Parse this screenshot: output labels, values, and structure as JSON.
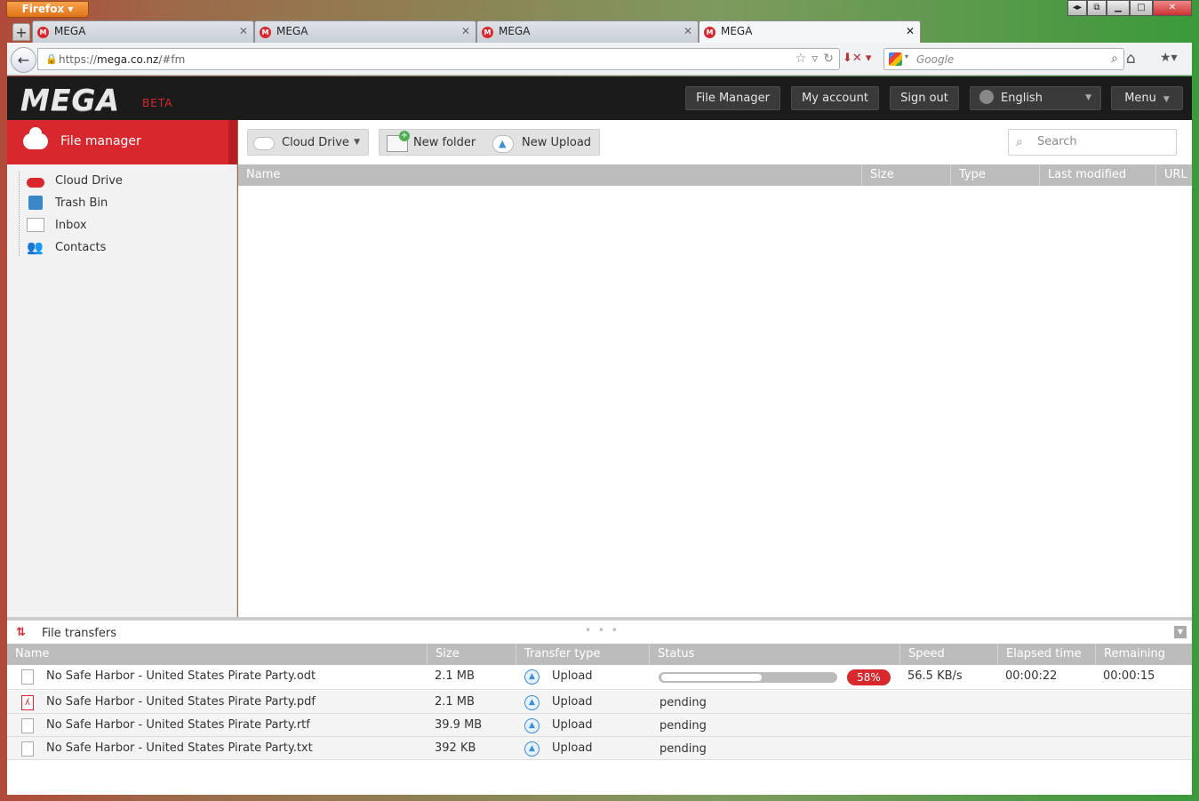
{
  "browser": {
    "app_button": "Firefox",
    "tabs": [
      {
        "label": "MEGA"
      },
      {
        "label": "MEGA"
      },
      {
        "label": "MEGA"
      },
      {
        "label": "MEGA"
      }
    ],
    "url_prefix": "https://",
    "url_host": "mega.co.nz",
    "url_path": "/#fm",
    "search_placeholder": "Google"
  },
  "header": {
    "logo": "MEGA",
    "beta": "BETA",
    "nav": {
      "file_manager": "File Manager",
      "my_account": "My account",
      "sign_out": "Sign out",
      "language": "English",
      "menu": "Menu"
    }
  },
  "sidebar": {
    "title": "File manager",
    "items": [
      {
        "label": "Cloud Drive",
        "icon": "cloud-icon"
      },
      {
        "label": "Trash Bin",
        "icon": "trash-icon"
      },
      {
        "label": "Inbox",
        "icon": "inbox-icon"
      },
      {
        "label": "Contacts",
        "icon": "contacts-icon"
      }
    ]
  },
  "toolbar": {
    "cloud_drive": "Cloud Drive",
    "new_folder": "New folder",
    "new_upload": "New Upload",
    "search_placeholder": "Search"
  },
  "file_grid": {
    "columns": [
      "Name",
      "Size",
      "Type",
      "Last modified",
      "URL"
    ]
  },
  "transfers": {
    "title": "File transfers",
    "columns": [
      "Name",
      "Size",
      "Transfer type",
      "Status",
      "Speed",
      "Elapsed time",
      "Remaining time"
    ],
    "rows": [
      {
        "name": "No Safe Harbor - United States Pirate Party.odt",
        "size": "2.1 MB",
        "type": "Upload",
        "status": "",
        "progress": 58,
        "percent": "58%",
        "speed": "56.5 KB/s",
        "elapsed": "00:00:22",
        "remaining": "00:00:15"
      },
      {
        "name": "No Safe Harbor - United States Pirate Party.pdf",
        "size": "2.1 MB",
        "type": "Upload",
        "status": "pending",
        "speed": "",
        "elapsed": "",
        "remaining": ""
      },
      {
        "name": "No Safe Harbor - United States Pirate Party.rtf",
        "size": "39.9 MB",
        "type": "Upload",
        "status": "pending",
        "speed": "",
        "elapsed": "",
        "remaining": ""
      },
      {
        "name": "No Safe Harbor - United States Pirate Party.txt",
        "size": "392 KB",
        "type": "Upload",
        "status": "pending",
        "speed": "",
        "elapsed": "",
        "remaining": ""
      }
    ]
  },
  "colors": {
    "accent": "#d9272e",
    "header_bg": "#1b1b1b",
    "grid_header": "#bcbcbc"
  }
}
